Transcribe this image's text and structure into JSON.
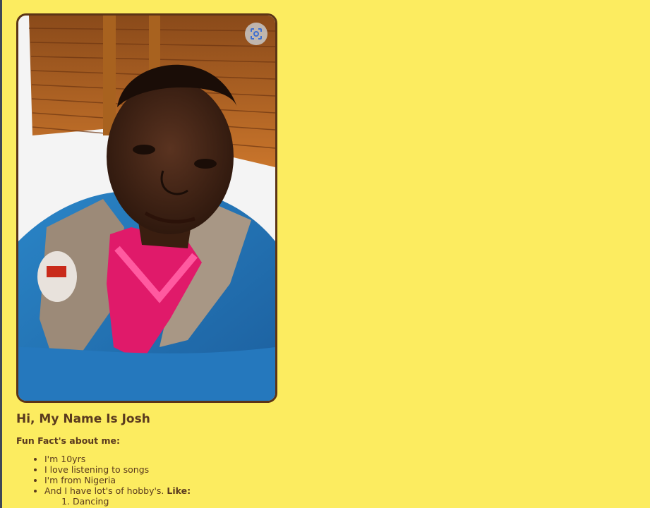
{
  "profile": {
    "photo_alt": "profile photo",
    "lens_icon": "visual-search-icon",
    "heading": "Hi, My Name Is Josh",
    "facts_title": "Fun Fact's about me:",
    "facts": [
      "I'm 10yrs",
      "I love listening to songs",
      "I'm from Nigeria"
    ],
    "hobby_intro": "And I have lot's of hobby's.",
    "hobby_like": "Like:",
    "hobbies": [
      "Dancing"
    ]
  },
  "colors": {
    "background": "#fcec60",
    "text": "#5a3a1e",
    "frame_border": "#5b3416"
  }
}
